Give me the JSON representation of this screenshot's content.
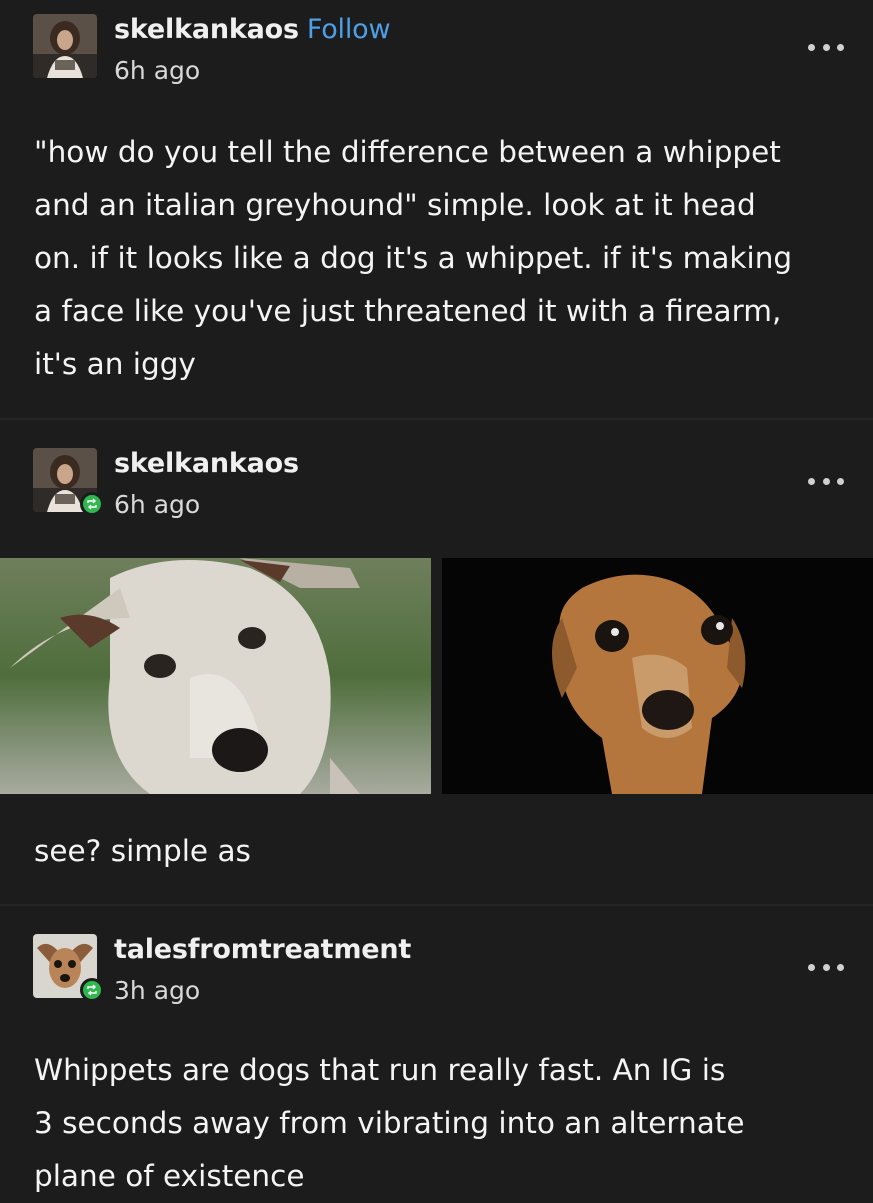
{
  "posts": [
    {
      "username": "skelkankaos",
      "follow_label": "Follow",
      "time": "6h ago",
      "more_icon": "more-horizontal-icon",
      "text": "\"how do you tell the difference between a whippet\nand an italian greyhound\" simple. look at it head\non. if it looks like a dog it's a whippet. if it's making\na face like you've just threatened it with a firearm,\nit's an iggy"
    },
    {
      "username": "skelkankaos",
      "time": "6h ago",
      "badge_icon": "reblog-icon",
      "more_icon": "more-horizontal-icon",
      "images": [
        "whippet-photo",
        "italian-greyhound-photo"
      ],
      "text": "see? simple as"
    },
    {
      "username": "talesfromtreatment",
      "time": "3h ago",
      "badge_icon": "reblog-icon",
      "more_icon": "more-horizontal-icon",
      "text": "Whippets are dogs that run really fast. An IG is\n3 seconds away from vibrating into an alternate\nplane of existence"
    }
  ],
  "colors": {
    "background": "#1c1c1c",
    "divider": "#262626",
    "follow": "#4d9fe6",
    "reblog_badge": "#2fb84f"
  }
}
